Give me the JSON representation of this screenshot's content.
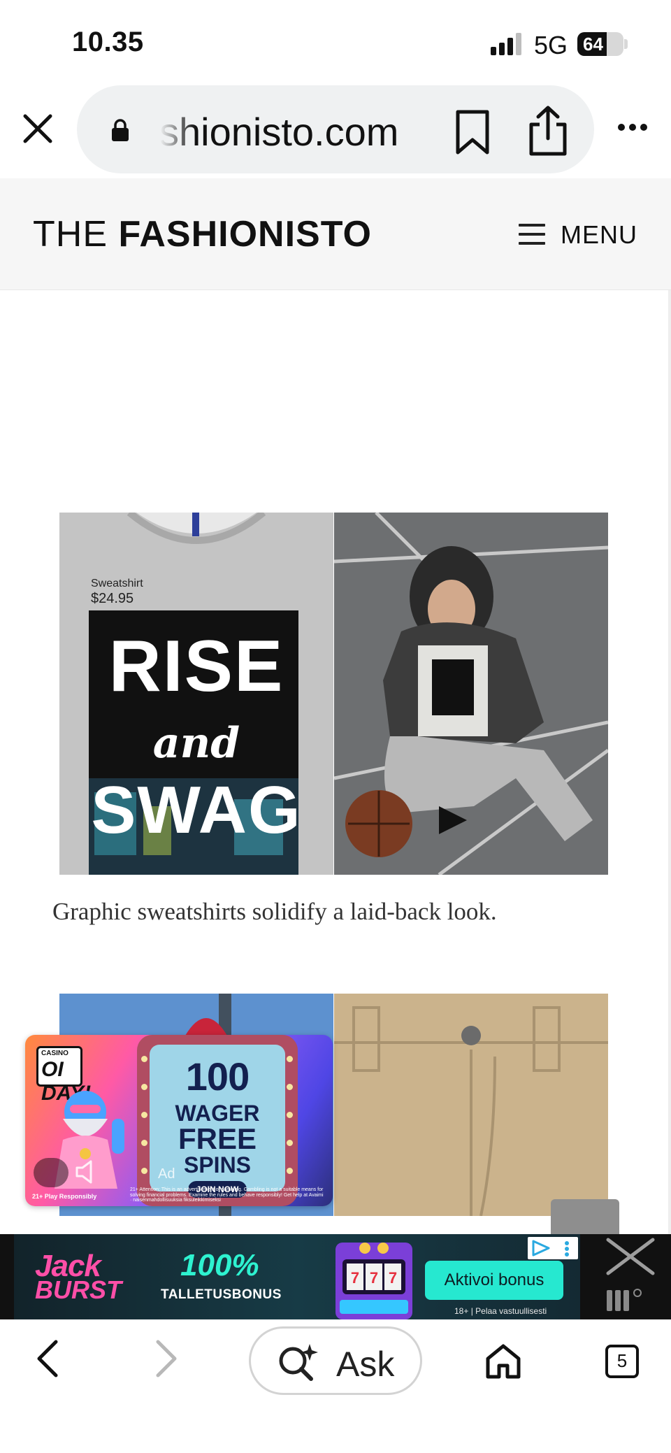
{
  "status_bar": {
    "time": "10.35",
    "network": "5G",
    "battery_level": "64",
    "battery_fraction": 0.64
  },
  "browser": {
    "url_display": "shionisto.com",
    "ask_label": "Ask",
    "tab_count": "5"
  },
  "site": {
    "logo_light": "THE ",
    "logo_bold": "FASHIONISTO",
    "menu_label": "MENU"
  },
  "article": {
    "product_label": "Sweatshirt",
    "product_price": "$24.95",
    "shirt_line_1": "RISE",
    "shirt_line_2": "and",
    "shirt_line_3": "SWAG",
    "caption": "Graphic sweatshirts solidify a laid-back look."
  },
  "casino_ad": {
    "logo_top": "CASINO",
    "logo_main": "OI DAY!",
    "number": "100",
    "wager": "WAGER",
    "free": "FREE",
    "spins": "SPINS",
    "cta": "JOIN NOW",
    "ad_label": "Ad",
    "responsibly": "21+ Play Responsibly",
    "disclaimer": "21+ Attention: This is an advertisement of gambling. Gambling is not a suitable means for solving financial problems. Examine the rules and behave responsibly! Get help at Avaimi · naisenmahdollisuuksia fiksuleikkimiseksi"
  },
  "banner_ad": {
    "brand_line_1": "Jack",
    "brand_line_2": "BURST",
    "headline": "100%",
    "subline": "TALLETUSBONUS",
    "cta": "Aktivoi bonus",
    "note": "18+ | Pelaa vastuullisesti"
  },
  "colors": {
    "banner_accent": "#26e8d0",
    "brand_pink": "#ff4fa8",
    "casino_navy": "#13204f"
  }
}
